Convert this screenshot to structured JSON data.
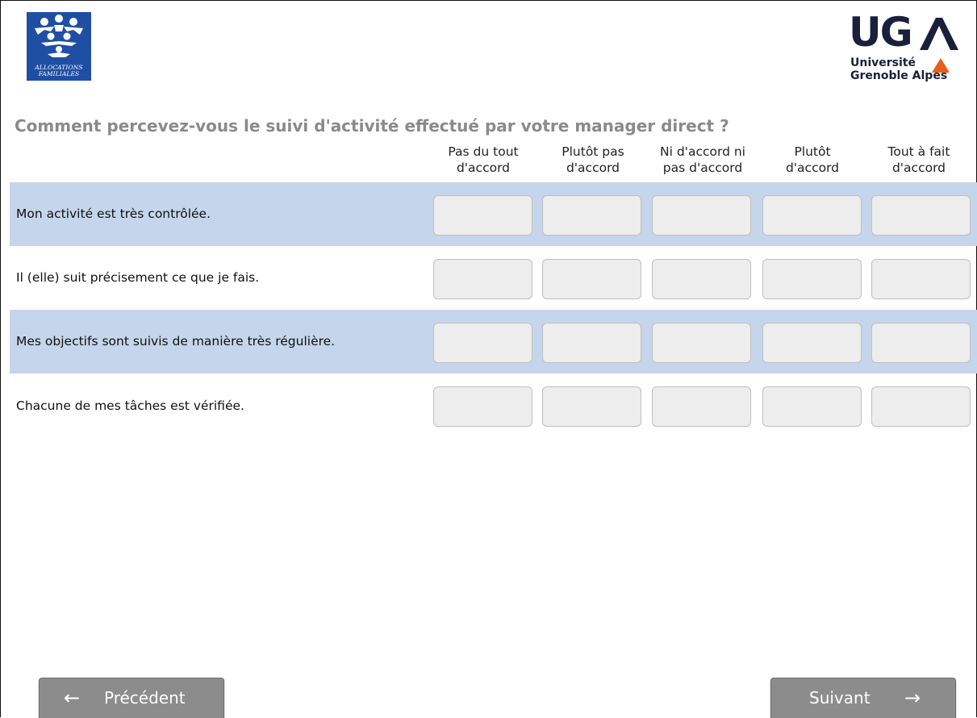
{
  "logos": {
    "caf": {
      "line1": "ALLOCATIONS",
      "line2": "FAMILIALES",
      "color": "#1f4fa3"
    },
    "uga": {
      "mark": "UG",
      "line1": "Université",
      "line2": "Grenoble Alpes",
      "accent": "#e85d1c",
      "color": "#1a1f3c"
    }
  },
  "question": {
    "title": "Comment percevez-vous le suivi d'activité effectué par votre manager direct ?"
  },
  "scale": [
    {
      "line1": "Pas du tout",
      "line2": "d'accord"
    },
    {
      "line1": "Plutôt pas",
      "line2": "d'accord"
    },
    {
      "line1": "Ni d'accord ni",
      "line2": "pas d'accord"
    },
    {
      "line1": "Plutôt",
      "line2": "d'accord"
    },
    {
      "line1": "Tout à fait",
      "line2": "d'accord"
    }
  ],
  "items": [
    {
      "label": "Mon activité est très contrôlée."
    },
    {
      "label": "Il (elle) suit précisement ce que je fais."
    },
    {
      "label": "Mes objectifs sont suivis de manière très régulière."
    },
    {
      "label": "Chacune de mes tâches est vérifiée."
    }
  ],
  "navigation": {
    "previous": "Précédent",
    "next": "Suivant",
    "previous_icon": "arrow-left-icon",
    "next_icon": "arrow-right-icon"
  },
  "colors": {
    "row_shade": "#c5d5eb",
    "title_gray": "#8a8a8a",
    "button_gray": "#8c8c8c"
  }
}
